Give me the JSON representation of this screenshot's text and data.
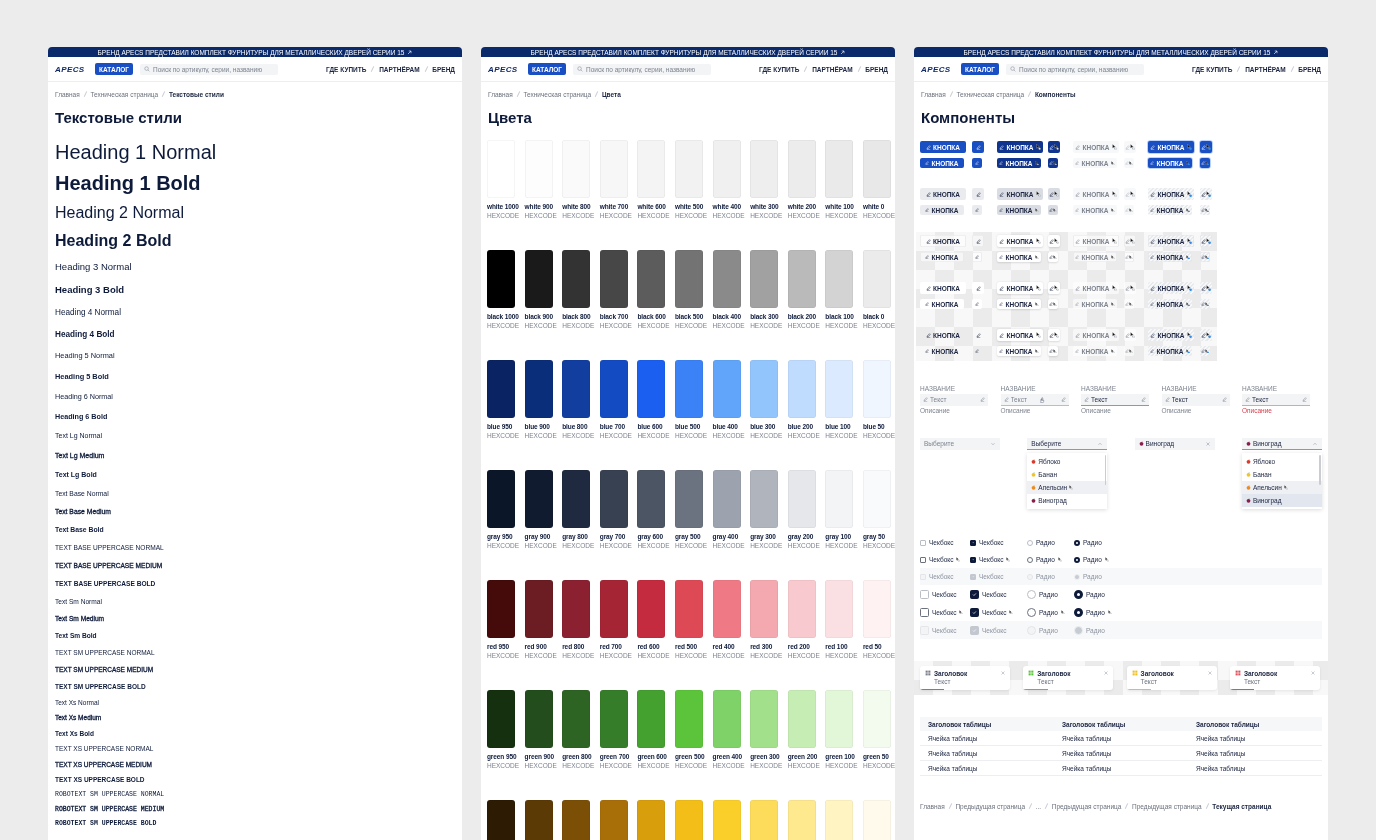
{
  "panels": [
    {
      "kind": "typography",
      "banner": {
        "text": "БРЕНД APECS ПРЕДСТАВИЛ КОМПЛЕКТ ФУРНИТУРЫ ДЛЯ МЕТАЛЛИЧЕСКИХ ДВЕРЕЙ СЕРИИ 15"
      },
      "header": {
        "logo": "APECS",
        "catalog_button": "КАТАЛОГ",
        "search": {
          "placeholder": "Поиск по артикулу, серии, названию"
        },
        "nav": [
          "ГДЕ КУПИТЬ",
          "ПАРТНЁРАМ",
          "БРЕНД"
        ]
      },
      "breadcrumbs": [
        {
          "label": "Главная",
          "current": false
        },
        {
          "label": "Техническая страница",
          "current": false
        },
        {
          "label": "Текстовые стили",
          "current": true
        }
      ],
      "title": "Текстовые стили",
      "text_styles": [
        {
          "kind": "h1",
          "text": "Heading 1 Normal",
          "bold": false,
          "medium": false
        },
        {
          "kind": "h1",
          "text": "Heading 1 Bold",
          "bold": true,
          "medium": false
        },
        {
          "kind": "h2",
          "text": "Heading 2 Normal",
          "bold": false,
          "medium": false
        },
        {
          "kind": "h2",
          "text": "Heading 2 Bold",
          "bold": true,
          "medium": false
        },
        {
          "kind": "h3",
          "text": "Heading 3 Normal",
          "bold": false,
          "medium": false
        },
        {
          "kind": "h3",
          "text": "Heading 3 Bold",
          "bold": true,
          "medium": false
        },
        {
          "kind": "h4",
          "text": "Heading 4 Normal",
          "bold": false,
          "medium": false
        },
        {
          "kind": "h4",
          "text": "Heading 4 Bold",
          "bold": true,
          "medium": false
        },
        {
          "kind": "h5",
          "text": "Heading 5 Normal",
          "bold": false,
          "medium": false
        },
        {
          "kind": "h5",
          "text": "Heading 5 Bold",
          "bold": true,
          "medium": false
        },
        {
          "kind": "h6",
          "text": "Heading 6 Normal",
          "bold": false,
          "medium": false
        },
        {
          "kind": "h6",
          "text": "Heading 6 Bold",
          "bold": true,
          "medium": false
        },
        {
          "kind": "lg",
          "text": "Text Lg Normal",
          "bold": false,
          "medium": false
        },
        {
          "kind": "lg",
          "text": "Text Lg Medium",
          "bold": false,
          "medium": true
        },
        {
          "kind": "lg",
          "text": "Text Lg Bold",
          "bold": true,
          "medium": false
        },
        {
          "kind": "base",
          "text": "Text Base Normal",
          "bold": false,
          "medium": false
        },
        {
          "kind": "base",
          "text": "Text Base Medium",
          "bold": false,
          "medium": true
        },
        {
          "kind": "base",
          "text": "Text Base Bold",
          "bold": true,
          "medium": false
        },
        {
          "kind": "basecaps",
          "text": "TEXT BASE UPPERCASE NORMAL",
          "bold": false,
          "medium": false
        },
        {
          "kind": "basecaps",
          "text": "TEXT BASE UPPERCASE MEDIUM",
          "bold": false,
          "medium": true
        },
        {
          "kind": "basecaps",
          "text": "TEXT BASE UPPERCASE BOLD",
          "bold": true,
          "medium": false
        },
        {
          "kind": "sm",
          "text": "Text Sm Normal",
          "bold": false,
          "medium": false
        },
        {
          "kind": "sm",
          "text": "Text Sm Medium",
          "bold": false,
          "medium": true
        },
        {
          "kind": "sm",
          "text": "Text Sm Bold",
          "bold": true,
          "medium": false
        },
        {
          "kind": "smcaps",
          "text": "TEXT SM UPPERCASE NORMAL",
          "bold": false,
          "medium": false
        },
        {
          "kind": "smcaps",
          "text": "TEXT SM UPPERCASE MEDIUM",
          "bold": false,
          "medium": true
        },
        {
          "kind": "smcaps",
          "text": "TEXT SM UPPERCASE BOLD",
          "bold": true,
          "medium": false
        },
        {
          "kind": "xs",
          "text": "Text Xs Normal",
          "bold": false,
          "medium": false
        },
        {
          "kind": "xs",
          "text": "Text Xs Medium",
          "bold": false,
          "medium": true
        },
        {
          "kind": "xs",
          "text": "Text Xs Bold",
          "bold": true,
          "medium": false
        },
        {
          "kind": "xscaps",
          "text": "TEXT XS UPPERCASE NORMAL",
          "bold": false,
          "medium": false
        },
        {
          "kind": "xscaps",
          "text": "TEXT XS UPPERCASE MEDIUM",
          "bold": false,
          "medium": true
        },
        {
          "kind": "xscaps",
          "text": "TEXT XS UPPERCASE BOLD",
          "bold": true,
          "medium": false
        },
        {
          "kind": "robo",
          "text": "ROBOTEXT SM UPPERCASE NORMAL",
          "bold": false,
          "medium": false
        },
        {
          "kind": "robo",
          "text": "ROBOTEXT SM UPPERCASE MEDIUM",
          "bold": false,
          "medium": true
        },
        {
          "kind": "robo",
          "text": "ROBOTEXT SM UPPERCASE BOLD",
          "bold": true,
          "medium": false
        }
      ]
    },
    {
      "kind": "colors",
      "banner": {
        "text": "БРЕНД APECS ПРЕДСТАВИЛ КОМПЛЕКТ ФУРНИТУРЫ ДЛЯ МЕТАЛЛИЧЕСКИХ ДВЕРЕЙ СЕРИИ 15"
      },
      "header": {
        "logo": "APECS",
        "catalog_button": "КАТАЛОГ",
        "search": {
          "placeholder": "Поиск по артикулу, серии, названию"
        },
        "nav": [
          "ГДЕ КУПИТЬ",
          "ПАРТНЁРАМ",
          "БРЕНД"
        ]
      },
      "breadcrumbs": [
        {
          "label": "Главная",
          "current": false
        },
        {
          "label": "Техническая страница",
          "current": false
        },
        {
          "label": "Цвета",
          "current": true
        }
      ],
      "title": "Цвета",
      "palette": [
        {
          "swatches": [
            {
              "name": "white 1000",
              "code": "HEXCODE",
              "color": "#ffffff"
            },
            {
              "name": "white 900",
              "code": "HEXCODE",
              "color": "#fdfdfd"
            },
            {
              "name": "white 800",
              "code": "HEXCODE",
              "color": "#fafafa"
            },
            {
              "name": "white 700",
              "code": "HEXCODE",
              "color": "#f7f7f7"
            },
            {
              "name": "white 600",
              "code": "HEXCODE",
              "color": "#f4f4f4"
            },
            {
              "name": "white 500",
              "code": "HEXCODE",
              "color": "#f2f2f2"
            },
            {
              "name": "white 400",
              "code": "HEXCODE",
              "color": "#f0f0f0"
            },
            {
              "name": "white 300",
              "code": "HEXCODE",
              "color": "#eeeeee"
            },
            {
              "name": "white 200",
              "code": "HEXCODE",
              "color": "#ececec"
            },
            {
              "name": "white 100",
              "code": "HEXCODE",
              "color": "#eaeaea"
            },
            {
              "name": "white 0",
              "code": "HEXCODE",
              "color": "#e8e8e8"
            }
          ]
        },
        {
          "swatches": [
            {
              "name": "black 1000",
              "code": "HEXCODE",
              "color": "#000000"
            },
            {
              "name": "black 900",
              "code": "HEXCODE",
              "color": "#1a1a1a"
            },
            {
              "name": "black 800",
              "code": "HEXCODE",
              "color": "#333333"
            },
            {
              "name": "black 700",
              "code": "HEXCODE",
              "color": "#474747"
            },
            {
              "name": "black 600",
              "code": "HEXCODE",
              "color": "#5c5c5c"
            },
            {
              "name": "black 500",
              "code": "HEXCODE",
              "color": "#737373"
            },
            {
              "name": "black 400",
              "code": "HEXCODE",
              "color": "#8a8a8a"
            },
            {
              "name": "black 300",
              "code": "HEXCODE",
              "color": "#a1a1a1"
            },
            {
              "name": "black 200",
              "code": "HEXCODE",
              "color": "#bababa"
            },
            {
              "name": "black 100",
              "code": "HEXCODE",
              "color": "#d3d3d3"
            },
            {
              "name": "black 0",
              "code": "HEXCODE",
              "color": "#ebebeb"
            }
          ]
        },
        {
          "swatches": [
            {
              "name": "blue 950",
              "code": "HEXCODE",
              "color": "#0a2463"
            },
            {
              "name": "blue 900",
              "code": "HEXCODE",
              "color": "#0b2e7a"
            },
            {
              "name": "blue 800",
              "code": "HEXCODE",
              "color": "#123ea0"
            },
            {
              "name": "blue 700",
              "code": "HEXCODE",
              "color": "#134bc2"
            },
            {
              "name": "blue 600",
              "code": "HEXCODE",
              "color": "#1a5ff0"
            },
            {
              "name": "blue 500",
              "code": "HEXCODE",
              "color": "#3b82f6"
            },
            {
              "name": "blue 400",
              "code": "HEXCODE",
              "color": "#60a5fa"
            },
            {
              "name": "blue 300",
              "code": "HEXCODE",
              "color": "#93c5fd"
            },
            {
              "name": "blue 200",
              "code": "HEXCODE",
              "color": "#bfdbfe"
            },
            {
              "name": "blue 100",
              "code": "HEXCODE",
              "color": "#dbeafe"
            },
            {
              "name": "blue 50",
              "code": "HEXCODE",
              "color": "#eff6ff"
            }
          ]
        },
        {
          "swatches": [
            {
              "name": "gray 950",
              "code": "HEXCODE",
              "color": "#0b1629"
            },
            {
              "name": "gray 900",
              "code": "HEXCODE",
              "color": "#111b30"
            },
            {
              "name": "gray 800",
              "code": "HEXCODE",
              "color": "#1f2a40"
            },
            {
              "name": "gray 700",
              "code": "HEXCODE",
              "color": "#374151"
            },
            {
              "name": "gray 600",
              "code": "HEXCODE",
              "color": "#4b5563"
            },
            {
              "name": "gray 500",
              "code": "HEXCODE",
              "color": "#6b7280"
            },
            {
              "name": "gray 400",
              "code": "HEXCODE",
              "color": "#9ca3af"
            },
            {
              "name": "gray 300",
              "code": "HEXCODE",
              "color": "#b0b4bc"
            },
            {
              "name": "gray 200",
              "code": "HEXCODE",
              "color": "#e5e7eb"
            },
            {
              "name": "gray 100",
              "code": "HEXCODE",
              "color": "#f3f4f6"
            },
            {
              "name": "gray 50",
              "code": "HEXCODE",
              "color": "#f9fafb"
            }
          ]
        },
        {
          "swatches": [
            {
              "name": "red 950",
              "code": "HEXCODE",
              "color": "#450a0a"
            },
            {
              "name": "red 900",
              "code": "HEXCODE",
              "color": "#6b1d23"
            },
            {
              "name": "red 800",
              "code": "HEXCODE",
              "color": "#8a2030"
            },
            {
              "name": "red 700",
              "code": "HEXCODE",
              "color": "#a52535"
            },
            {
              "name": "red 600",
              "code": "HEXCODE",
              "color": "#c42b3e"
            },
            {
              "name": "red 500",
              "code": "HEXCODE",
              "color": "#dd4a56"
            },
            {
              "name": "red 400",
              "code": "HEXCODE",
              "color": "#ef7a85"
            },
            {
              "name": "red 300",
              "code": "HEXCODE",
              "color": "#f4a9b0"
            },
            {
              "name": "red 200",
              "code": "HEXCODE",
              "color": "#f8c9ce"
            },
            {
              "name": "red 100",
              "code": "HEXCODE",
              "color": "#fbe0e3"
            },
            {
              "name": "red 50",
              "code": "HEXCODE",
              "color": "#fef2f2"
            }
          ]
        },
        {
          "swatches": [
            {
              "name": "green 950",
              "code": "HEXCODE",
              "color": "#14300e"
            },
            {
              "name": "green 900",
              "code": "HEXCODE",
              "color": "#234d1c"
            },
            {
              "name": "green 800",
              "code": "HEXCODE",
              "color": "#2d6424"
            },
            {
              "name": "green 700",
              "code": "HEXCODE",
              "color": "#367d29"
            },
            {
              "name": "green 600",
              "code": "HEXCODE",
              "color": "#44a02f"
            },
            {
              "name": "green 500",
              "code": "HEXCODE",
              "color": "#5cc43a"
            },
            {
              "name": "green 400",
              "code": "HEXCODE",
              "color": "#7fd267"
            },
            {
              "name": "green 300",
              "code": "HEXCODE",
              "color": "#a3e08c"
            },
            {
              "name": "green 200",
              "code": "HEXCODE",
              "color": "#c6edb4"
            },
            {
              "name": "green 100",
              "code": "HEXCODE",
              "color": "#e2f6d8"
            },
            {
              "name": "green 50",
              "code": "HEXCODE",
              "color": "#f2fbee"
            }
          ]
        },
        {
          "swatches": [
            {
              "color": "#2d1b04"
            },
            {
              "color": "#5c3a05"
            },
            {
              "color": "#7c4f06"
            },
            {
              "color": "#a86f08"
            },
            {
              "color": "#d99e0c"
            },
            {
              "color": "#f2be17"
            },
            {
              "color": "#fbcf2a"
            },
            {
              "color": "#fddc5c"
            },
            {
              "color": "#fee98f"
            },
            {
              "color": "#fff4c2"
            },
            {
              "color": "#fffaeb"
            }
          ]
        }
      ]
    },
    {
      "kind": "components",
      "banner": {
        "text": "БРЕНД APECS ПРЕДСТАВИЛ КОМПЛЕКТ ФУРНИТУРЫ ДЛЯ МЕТАЛЛИЧЕСКИХ ДВЕРЕЙ СЕРИИ 15"
      },
      "header": {
        "logo": "APECS",
        "catalog_button": "КАТАЛОГ",
        "search": {
          "placeholder": "Поиск по артикулу, серии, названию"
        },
        "nav": [
          "ГДЕ КУПИТЬ",
          "ПАРТНЁРАМ",
          "БРЕНД"
        ]
      },
      "breadcrumbs": [
        {
          "label": "Главная",
          "current": false
        },
        {
          "label": "Техническая страница",
          "current": false
        },
        {
          "label": "Компоненты",
          "current": true
        }
      ],
      "title": "Компоненты",
      "button_sets": [
        {
          "kind": "plain",
          "groups": [
            {
              "kind": "primary",
              "rows": [
                {
                  "kind": "large",
                  "cells": [
                    {
                      "label": "КНОПКА",
                      "kind": "default"
                    },
                    {
                      "kind": "default"
                    },
                    {
                      "label": "КНОПКА",
                      "kind": "hover"
                    },
                    {
                      "kind": "hover"
                    },
                    {
                      "label": "КНОПКА",
                      "kind": "disabled"
                    },
                    {
                      "kind": "disabled"
                    },
                    {
                      "label": "КНОПКА",
                      "kind": "focus"
                    },
                    {
                      "kind": "focus"
                    }
                  ]
                },
                {
                  "kind": "small",
                  "cells": [
                    {
                      "label": "КНОПКА",
                      "kind": "default"
                    },
                    {
                      "kind": "default"
                    },
                    {
                      "label": "КНОПКА",
                      "kind": "hover"
                    },
                    {
                      "kind": "hover"
                    },
                    {
                      "label": "КНОПКА",
                      "kind": "disabled"
                    },
                    {
                      "kind": "disabled"
                    },
                    {
                      "label": "КНОПКА",
                      "kind": "focus"
                    },
                    {
                      "kind": "focus"
                    }
                  ]
                }
              ]
            },
            {
              "kind": "secondary",
              "rows": [
                {
                  "kind": "large",
                  "cells": [
                    {
                      "label": "КНОПКА",
                      "kind": "default"
                    },
                    {
                      "kind": "default"
                    },
                    {
                      "label": "КНОПКА",
                      "kind": "hover"
                    },
                    {
                      "kind": "hover"
                    },
                    {
                      "label": "КНОПКА",
                      "kind": "disabled"
                    },
                    {
                      "kind": "disabled"
                    },
                    {
                      "label": "КНОПКА",
                      "kind": "focus"
                    },
                    {
                      "kind": "focus"
                    }
                  ]
                },
                {
                  "kind": "small",
                  "cells": [
                    {
                      "label": "КНОПКА",
                      "kind": "default"
                    },
                    {
                      "kind": "default"
                    },
                    {
                      "label": "КНОПКА",
                      "kind": "hover"
                    },
                    {
                      "kind": "hover"
                    },
                    {
                      "label": "КНОПКА",
                      "kind": "disabled"
                    },
                    {
                      "kind": "disabled"
                    },
                    {
                      "label": "КНОПКА",
                      "kind": "focus"
                    },
                    {
                      "kind": "focus"
                    }
                  ]
                }
              ]
            }
          ]
        },
        {
          "kind": "checker",
          "groups": [
            {
              "kind": "outline",
              "rows": [
                {
                  "kind": "large",
                  "cells": [
                    {
                      "label": "КНОПКА",
                      "kind": "default"
                    },
                    {
                      "kind": "default"
                    },
                    {
                      "label": "КНОПКА",
                      "kind": "hover"
                    },
                    {
                      "kind": "hover"
                    },
                    {
                      "label": "КНОПКА",
                      "kind": "disabled"
                    },
                    {
                      "kind": "disabled"
                    },
                    {
                      "label": "КНОПКА",
                      "kind": "focus"
                    },
                    {
                      "kind": "focus"
                    }
                  ]
                },
                {
                  "kind": "small",
                  "cells": [
                    {
                      "label": "КНОПКА",
                      "kind": "default"
                    },
                    {
                      "kind": "default"
                    },
                    {
                      "label": "КНОПКА",
                      "kind": "hover"
                    },
                    {
                      "kind": "hover"
                    },
                    {
                      "label": "КНОПКА",
                      "kind": "disabled"
                    },
                    {
                      "kind": "disabled"
                    },
                    {
                      "label": "КНОПКА",
                      "kind": "focus"
                    },
                    {
                      "kind": "focus"
                    }
                  ]
                }
              ]
            },
            {
              "kind": "white",
              "rows": [
                {
                  "kind": "large",
                  "cells": [
                    {
                      "label": "КНОПКА",
                      "kind": "default"
                    },
                    {
                      "kind": "default"
                    },
                    {
                      "label": "КНОПКА",
                      "kind": "hover"
                    },
                    {
                      "kind": "hover"
                    },
                    {
                      "label": "КНОПКА",
                      "kind": "disabled"
                    },
                    {
                      "kind": "disabled"
                    },
                    {
                      "label": "КНОПКА",
                      "kind": "focus"
                    },
                    {
                      "kind": "focus"
                    }
                  ]
                },
                {
                  "kind": "small",
                  "cells": [
                    {
                      "label": "КНОПКА",
                      "kind": "default"
                    },
                    {
                      "kind": "default"
                    },
                    {
                      "label": "КНОПКА",
                      "kind": "hover"
                    },
                    {
                      "kind": "hover"
                    },
                    {
                      "label": "КНОПКА",
                      "kind": "disabled"
                    },
                    {
                      "kind": "disabled"
                    },
                    {
                      "label": "КНОПКА",
                      "kind": "focus"
                    },
                    {
                      "kind": "focus"
                    }
                  ]
                }
              ]
            },
            {
              "kind": "clear",
              "rows": [
                {
                  "kind": "large",
                  "cells": [
                    {
                      "label": "КНОПКА",
                      "kind": "default"
                    },
                    {
                      "kind": "default"
                    },
                    {
                      "label": "КНОПКА",
                      "kind": "hover"
                    },
                    {
                      "kind": "hover"
                    },
                    {
                      "label": "КНОПКА",
                      "kind": "disabled"
                    },
                    {
                      "kind": "disabled"
                    },
                    {
                      "label": "КНОПКА",
                      "kind": "focus"
                    },
                    {
                      "kind": "focus"
                    }
                  ]
                },
                {
                  "kind": "small",
                  "cells": [
                    {
                      "label": "КНОПКА",
                      "kind": "default"
                    },
                    {
                      "kind": "default"
                    },
                    {
                      "label": "КНОПКА",
                      "kind": "hover"
                    },
                    {
                      "kind": "hover"
                    },
                    {
                      "label": "КНОПКА",
                      "kind": "disabled"
                    },
                    {
                      "kind": "disabled"
                    },
                    {
                      "label": "КНОПКА",
                      "kind": "focus"
                    },
                    {
                      "kind": "focus"
                    }
                  ]
                }
              ]
            }
          ]
        }
      ],
      "fields": [
        {
          "label": "НАЗВАНИЕ",
          "placeholder": "Текст",
          "description": "Описание",
          "kind": "default"
        },
        {
          "label": "НАЗВАНИЕ",
          "placeholder": "Текст",
          "description": "Описание",
          "kind": "hover"
        },
        {
          "label": "НАЗВАНИЕ",
          "value": "Текст",
          "description": "Описание",
          "kind": "focus"
        },
        {
          "label": "НАЗВАНИЕ",
          "value": "Текст",
          "description": "Описание",
          "kind": "filled"
        },
        {
          "label": "НАЗВАНИЕ",
          "value": "Текст",
          "description": "Описание",
          "kind": "error"
        }
      ],
      "selects": [
        {
          "placeholder": "Выберите",
          "open": false,
          "clearable": false
        },
        {
          "placeholder": "Выберите",
          "open": true,
          "clearable": false,
          "options": [
            {
              "label": "Яблоко",
              "color": "#d93a2b",
              "selected": false,
              "hovered": false
            },
            {
              "label": "Банан",
              "color": "#f2c230",
              "selected": false,
              "hovered": false
            },
            {
              "label": "Апельсин",
              "color": "#f08a1c",
              "selected": false,
              "hovered": true
            },
            {
              "label": "Виноград",
              "color": "#8b1d4d",
              "selected": false,
              "hovered": false
            }
          ]
        },
        {
          "value": "Виноград",
          "color": "#8b1d4d",
          "open": false,
          "clearable": true
        },
        {
          "value": "Виноград",
          "color": "#8b1d4d",
          "open": true,
          "clearable": false,
          "options": [
            {
              "label": "Яблоко",
              "color": "#d93a2b",
              "selected": false,
              "hovered": false
            },
            {
              "label": "Банан",
              "color": "#f2c230",
              "selected": false,
              "hovered": false
            },
            {
              "label": "Апельсин",
              "color": "#f08a1c",
              "selected": false,
              "hovered": true
            },
            {
              "label": "Виноград",
              "color": "#8b1d4d",
              "selected": true,
              "hovered": false
            }
          ]
        }
      ],
      "choices": [
        {
          "kind": "small",
          "rows": [
            {
              "kind": "default",
              "items": [
                {
                  "kind": "checkbox",
                  "label": "Чекбокс",
                  "checked": false
                },
                {
                  "kind": "checkbox",
                  "label": "Чекбокс",
                  "checked": true
                },
                {
                  "kind": "radio",
                  "label": "Радио",
                  "checked": false
                },
                {
                  "kind": "radio",
                  "label": "Радио",
                  "checked": true
                }
              ]
            },
            {
              "kind": "hover",
              "items": [
                {
                  "kind": "checkbox",
                  "label": "Чекбокс",
                  "checked": false
                },
                {
                  "kind": "checkbox",
                  "label": "Чекбокс",
                  "checked": true
                },
                {
                  "kind": "radio",
                  "label": "Радио",
                  "checked": false
                },
                {
                  "kind": "radio",
                  "label": "Радио",
                  "checked": true
                }
              ]
            },
            {
              "kind": "disabled",
              "items": [
                {
                  "kind": "checkbox",
                  "label": "Чекбокс",
                  "checked": false
                },
                {
                  "kind": "checkbox",
                  "label": "Чекбокс",
                  "checked": true
                },
                {
                  "kind": "radio",
                  "label": "Радио",
                  "checked": false
                },
                {
                  "kind": "radio",
                  "label": "Радио",
                  "checked": true
                }
              ]
            }
          ]
        },
        {
          "kind": "large",
          "rows": [
            {
              "kind": "default",
              "items": [
                {
                  "kind": "checkbox",
                  "label": "Чекбокс",
                  "checked": false
                },
                {
                  "kind": "checkbox",
                  "label": "Чекбокс",
                  "checked": true
                },
                {
                  "kind": "radio",
                  "label": "Радио",
                  "checked": false
                },
                {
                  "kind": "radio",
                  "label": "Радио",
                  "checked": true
                }
              ]
            },
            {
              "kind": "hover",
              "items": [
                {
                  "kind": "checkbox",
                  "label": "Чекбокс",
                  "checked": false
                },
                {
                  "kind": "checkbox",
                  "label": "Чекбокс",
                  "checked": true
                },
                {
                  "kind": "radio",
                  "label": "Радио",
                  "checked": false
                },
                {
                  "kind": "radio",
                  "label": "Радио",
                  "checked": true
                }
              ]
            },
            {
              "kind": "disabled",
              "items": [
                {
                  "kind": "checkbox",
                  "label": "Чекбокс",
                  "checked": false
                },
                {
                  "kind": "checkbox",
                  "label": "Чекбокс",
                  "checked": true
                },
                {
                  "kind": "radio",
                  "label": "Радио",
                  "checked": false
                },
                {
                  "kind": "radio",
                  "label": "Радио",
                  "checked": true
                }
              ]
            }
          ]
        }
      ],
      "toasts": [
        {
          "title": "Заголовок",
          "text": "Текст",
          "color": "#7a7f8c",
          "level": 0.27
        },
        {
          "title": "Заголовок",
          "text": "Текст",
          "color": "#5cc43a",
          "level": 0.27
        },
        {
          "title": "Заголовок",
          "text": "Текст",
          "color": "#f2be17",
          "level": 0.27
        },
        {
          "title": "Заголовок",
          "text": "Текст",
          "color": "#e0505c",
          "level": 0.27
        }
      ],
      "table": {
        "columns": [
          "Заголовок таблицы",
          "Заголовок таблицы",
          "Заголовок таблицы"
        ],
        "rows": [
          [
            "Ячейка таблицы",
            "Ячейка таблицы",
            "Ячейка таблицы"
          ],
          [
            "Ячейка таблицы",
            "Ячейка таблицы",
            "Ячейка таблицы"
          ],
          [
            "Ячейка таблицы",
            "Ячейка таблицы",
            "Ячейка таблицы"
          ]
        ]
      },
      "sample_breadcrumbs": [
        {
          "label": "Главная",
          "current": false
        },
        {
          "label": "Предыдущая страница",
          "current": false
        },
        {
          "label": "...",
          "current": false
        },
        {
          "label": "Предыдущая страница",
          "current": false
        },
        {
          "label": "Предыдущая страница",
          "current": false
        },
        {
          "label": "Текущая страница",
          "current": true
        }
      ]
    }
  ]
}
